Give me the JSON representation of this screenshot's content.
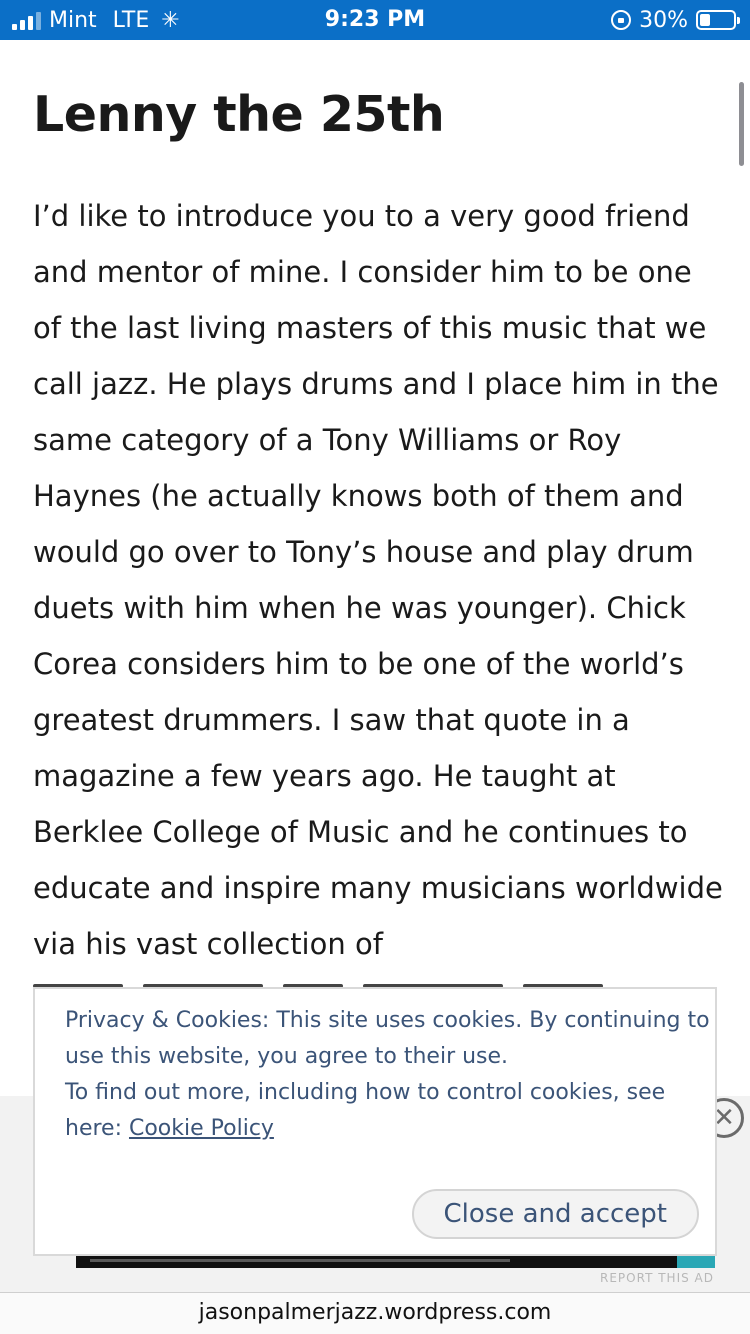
{
  "status_bar": {
    "carrier": "Mint",
    "network": "LTE",
    "activity_indicator": "spinner-icon",
    "time": "9:23 PM",
    "battery_percent": "30%",
    "battery_level": 0.3,
    "colors": {
      "background": "#0b6fc7",
      "text": "#ffffff"
    }
  },
  "article": {
    "title": "Lenny the 25th",
    "body": "I’d like to introduce you to a very good friend and mentor of mine. I consider him to be one of the last living masters of this music that we call jazz. He plays drums and I place him in the same category of a Tony Williams or Roy Haynes (he actually knows both of them and would go over to Tony’s house and play drum duets with him when he was younger). Chick Corea considers him to be one of the world’s greatest drummers. I saw that quote in a magazine a few years ago. He taught at Berklee College of Music and he continues to educate and inspire many musicians worldwide via his vast collection of"
  },
  "cookie_banner": {
    "text_line1": "Privacy & Cookies: This site uses cookies. By continuing to use this website, you agree to their use.",
    "text_line2": "To find out more, including how to control cookies, see here: ",
    "policy_link": "Cookie Policy",
    "accept_button": "Close and accept",
    "colors": {
      "text": "#3b5478",
      "border": "#d9d9d9"
    }
  },
  "ad": {
    "close_icon": "close-circle-icon",
    "close_glyph": "✕",
    "report_label": "REPORT THIS AD"
  },
  "browser": {
    "url": "jasonpalmerjazz.wordpress.com"
  }
}
